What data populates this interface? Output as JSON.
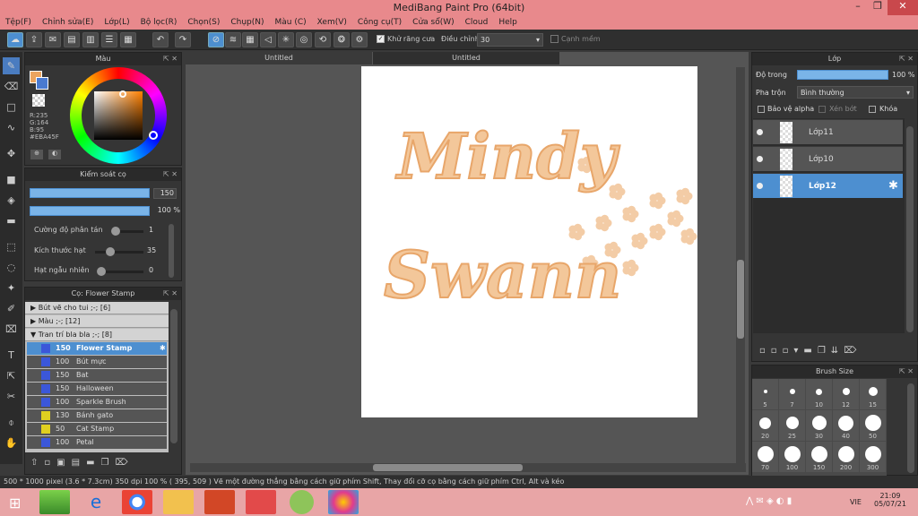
{
  "title": "MediBang Paint Pro (64bit)",
  "menu": [
    "Tệp(F)",
    "Chỉnh sửa(E)",
    "Lớp(L)",
    "Bộ lọc(R)",
    "Chọn(S)",
    "Chụp(N)",
    "Màu (C)",
    "Xem(V)",
    "Công cụ(T)",
    "Cửa sổ(W)",
    "Cloud",
    "Help"
  ],
  "toolbar": {
    "antialias_label": "Khử răng cưa",
    "adjust_label": "Điều chỉnh",
    "adjust_value": "30",
    "edge_label": "Cạnh mềm"
  },
  "color_panel": {
    "title": "Màu",
    "r": "R:235",
    "g": "G:164",
    "b": "B:95",
    "hex": "#EBA45F",
    "fg": "#eba45f",
    "bg": "#4a7ad0"
  },
  "brush_control": {
    "title": "Kiểm soát cọ",
    "size": "150",
    "opacity": "100 %",
    "rows": [
      {
        "label": "Cường độ phân tán",
        "value": "1"
      },
      {
        "label": "Kích thước hạt",
        "value": "35"
      },
      {
        "label": "Hạt ngẫu nhiên",
        "value": "0"
      }
    ]
  },
  "brush_panel": {
    "title": "Cọ: Flower Stamp",
    "groups": [
      "Bút vẽ cho tui ;-; [6]",
      "Màu ;-; [12]",
      "Tran trí bla bla ;-; [8]"
    ],
    "brushes": [
      {
        "size": "150",
        "name": "Flower Stamp",
        "color": "#3b57d9"
      },
      {
        "size": "100",
        "name": "Bút mực",
        "color": "#3b57d9"
      },
      {
        "size": "150",
        "name": "Bat",
        "color": "#3b57d9"
      },
      {
        "size": "150",
        "name": "Halloween",
        "color": "#3b57d9"
      },
      {
        "size": "100",
        "name": "Sparkle Brush",
        "color": "#3b57d9"
      },
      {
        "size": "130",
        "name": "Bánh gato",
        "color": "#e0d020"
      },
      {
        "size": "50",
        "name": "Cat Stamp",
        "color": "#e0d020"
      },
      {
        "size": "100",
        "name": "Petal",
        "color": "#3b57d9"
      }
    ]
  },
  "tabs": [
    "Untitled",
    "Untitled"
  ],
  "canvas": {
    "text1": "Mindy",
    "text2": "Swann",
    "accent": "#eba45f"
  },
  "layers_panel": {
    "title": "Lớp",
    "opacity_label": "Độ trong",
    "opacity_value": "100 %",
    "blend_label": "Pha trộn",
    "blend_value": "Bình thường",
    "protect_alpha": "Bảo vệ alpha",
    "clip": "Xén bớt",
    "lock": "Khóa",
    "layers": [
      "Lớp11",
      "Lớp10",
      "Lớp12"
    ]
  },
  "brush_size_panel": {
    "title": "Brush Size",
    "row1": [
      "5",
      "7",
      "10",
      "12",
      "15"
    ],
    "row2": [
      "20",
      "25",
      "30",
      "40",
      "50"
    ],
    "row3": [
      "70",
      "100",
      "150",
      "200",
      "300"
    ]
  },
  "status": "500 * 1000 pixel   (3.6 * 7.3cm)   350 dpi   100 %   ( 395, 509 )   Vẽ một đường thẳng bằng cách giữ phím Shift, Thay đổi cỡ cọ bằng cách giữ phím Ctrl, Alt và kéo",
  "taskbar": {
    "time": "21:09",
    "date": "05/07/21",
    "lang": "VIE"
  }
}
